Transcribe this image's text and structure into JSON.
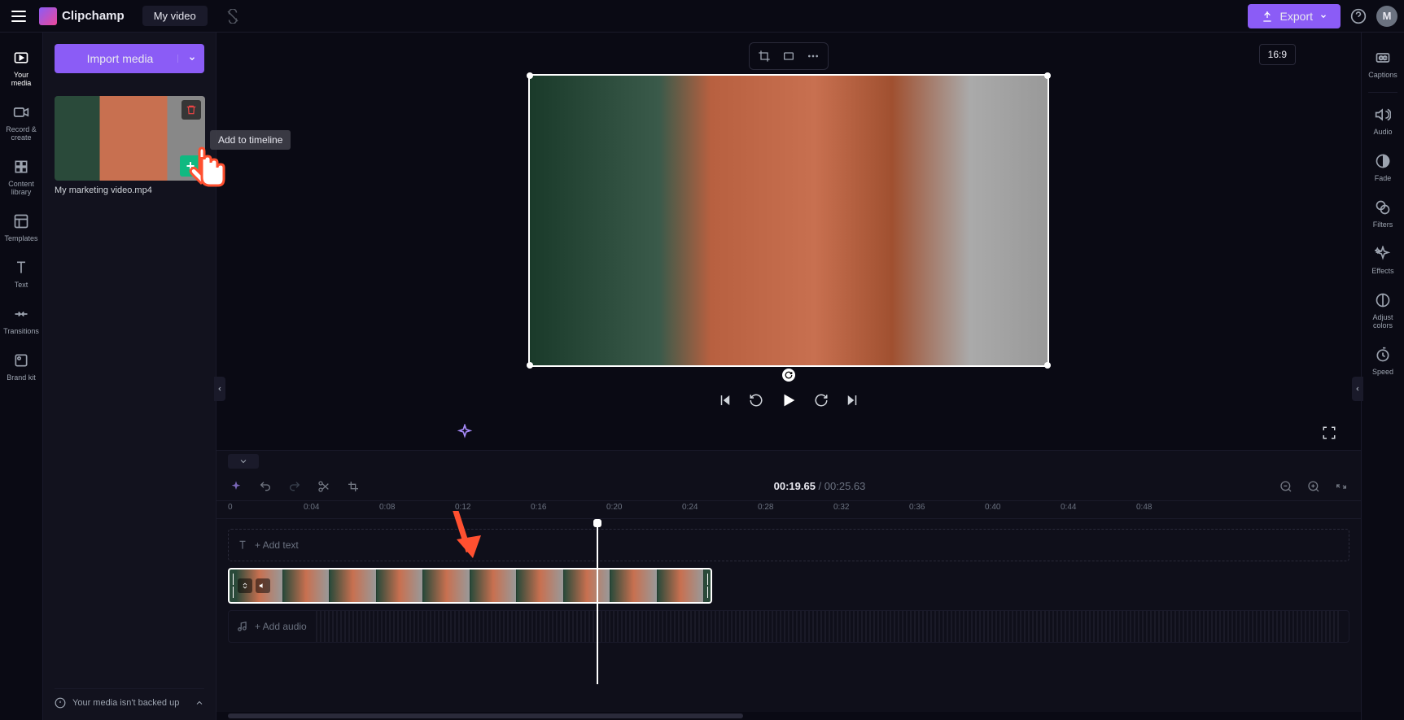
{
  "header": {
    "app_name": "Clipchamp",
    "video_title": "My video",
    "export_label": "Export",
    "aspect_ratio": "16:9",
    "avatar_initial": "M"
  },
  "left_sidebar": {
    "items": [
      {
        "label": "Your media"
      },
      {
        "label": "Record & create"
      },
      {
        "label": "Content library"
      },
      {
        "label": "Templates"
      },
      {
        "label": "Text"
      },
      {
        "label": "Transitions"
      },
      {
        "label": "Brand kit"
      }
    ]
  },
  "media_panel": {
    "import_label": "Import media",
    "media_filename": "My marketing video.mp4",
    "tooltip_text": "Add to timeline",
    "footer_message": "Your media isn't backed up"
  },
  "right_sidebar": {
    "items": [
      {
        "label": "Captions"
      },
      {
        "label": "Audio"
      },
      {
        "label": "Fade"
      },
      {
        "label": "Filters"
      },
      {
        "label": "Effects"
      },
      {
        "label": "Adjust colors"
      },
      {
        "label": "Speed"
      }
    ]
  },
  "timeline": {
    "time_current": "00:19.65",
    "time_separator": " / ",
    "time_total": "00:25.63",
    "ruler_marks": [
      "0",
      "0:04",
      "0:08",
      "0:12",
      "0:16",
      "0:20",
      "0:24",
      "0:28",
      "0:32",
      "0:36",
      "0:40",
      "0:44",
      "0:48"
    ],
    "add_text_label": "+ Add text",
    "add_audio_label": "+ Add audio"
  }
}
